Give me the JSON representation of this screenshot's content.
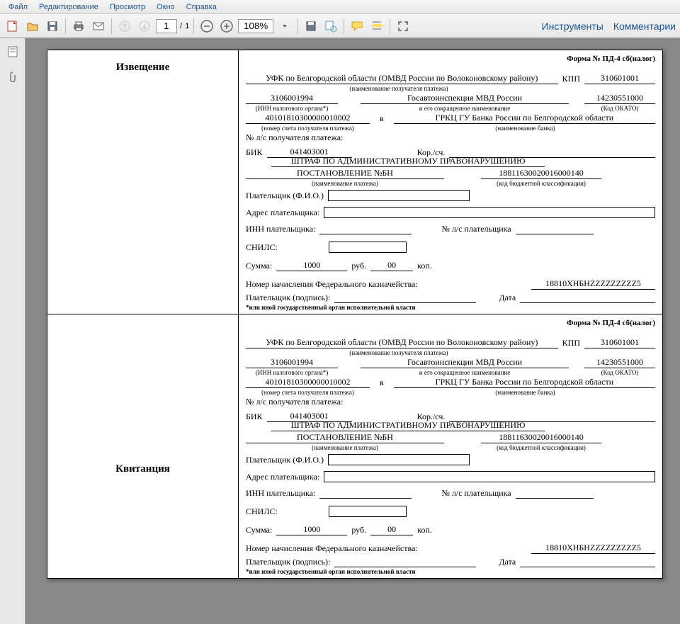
{
  "menu": {
    "file": "Файл",
    "edit": "Редактирование",
    "view": "Просмотр",
    "window": "Окно",
    "help": "Справка"
  },
  "toolbar": {
    "page_current": "1",
    "page_sep": "/",
    "page_total": "1",
    "zoom": "108%",
    "tools": "Инструменты",
    "comments": "Комментарии"
  },
  "form": {
    "title_notification": "Извещение",
    "title_receipt": "Квитанция",
    "header": "Форма № ПД-4 сб(налог)",
    "recipient": "УФК по Белгородской области (ОМВД России по Волоконовскому району)",
    "recipient_cap": "(наименование получателя платежа)",
    "kpp_lbl": "КПП",
    "kpp": "310601001",
    "inn": "3106001994",
    "inn_cap": "(ИНН налогового органа*)",
    "gai": "Госавтоинспекция МВД России",
    "gai_cap": "и его сокращенное наименование",
    "okato": "14230551000",
    "okato_cap": "(Код ОКАТО)",
    "account": "40101810300000010002",
    "account_cap": "(номер счета получателя платежа)",
    "in_lbl": "в",
    "bank": "ГРКЦ ГУ Банка России по Белгородской области",
    "bank_cap": "(наименование банка)",
    "ls_recipient": "№ л/с получателя платежа:",
    "bik_lbl": "БИК",
    "bik": "041403001",
    "kor_lbl": "Кор./сч.",
    "purpose1": "ШТРАФ ПО АДМИНИСТРАТИВНОМУ ПРАВОНАРУШЕНИЮ",
    "purpose2": "ПОСТАНОВЛЕНИЕ №БН",
    "purpose_cap": "(наименование платежа)",
    "kbk": "18811630020016000140",
    "kbk_cap": "(код бюджетной классификации)",
    "payer_fio": "Плательщик (Ф.И.О.)",
    "payer_addr": "Адрес плательщика:",
    "payer_inn": "ИНН плательщика:",
    "payer_ls": "№ л/с плательщика",
    "snils": "СНИЛС:",
    "sum_lbl": "Сумма:",
    "sum_rub": "1000",
    "rub": "руб.",
    "sum_kop": "00",
    "kop": "коп.",
    "accrual_lbl": "Номер начисления Федерального казначейства:",
    "accrual": "18810ХНБНZZZZZZZZZ5",
    "sign_lbl": "Плательщик (подпись):",
    "date_lbl": "Дата",
    "footnote": "*или иной государственный орган исполнительной власти"
  }
}
